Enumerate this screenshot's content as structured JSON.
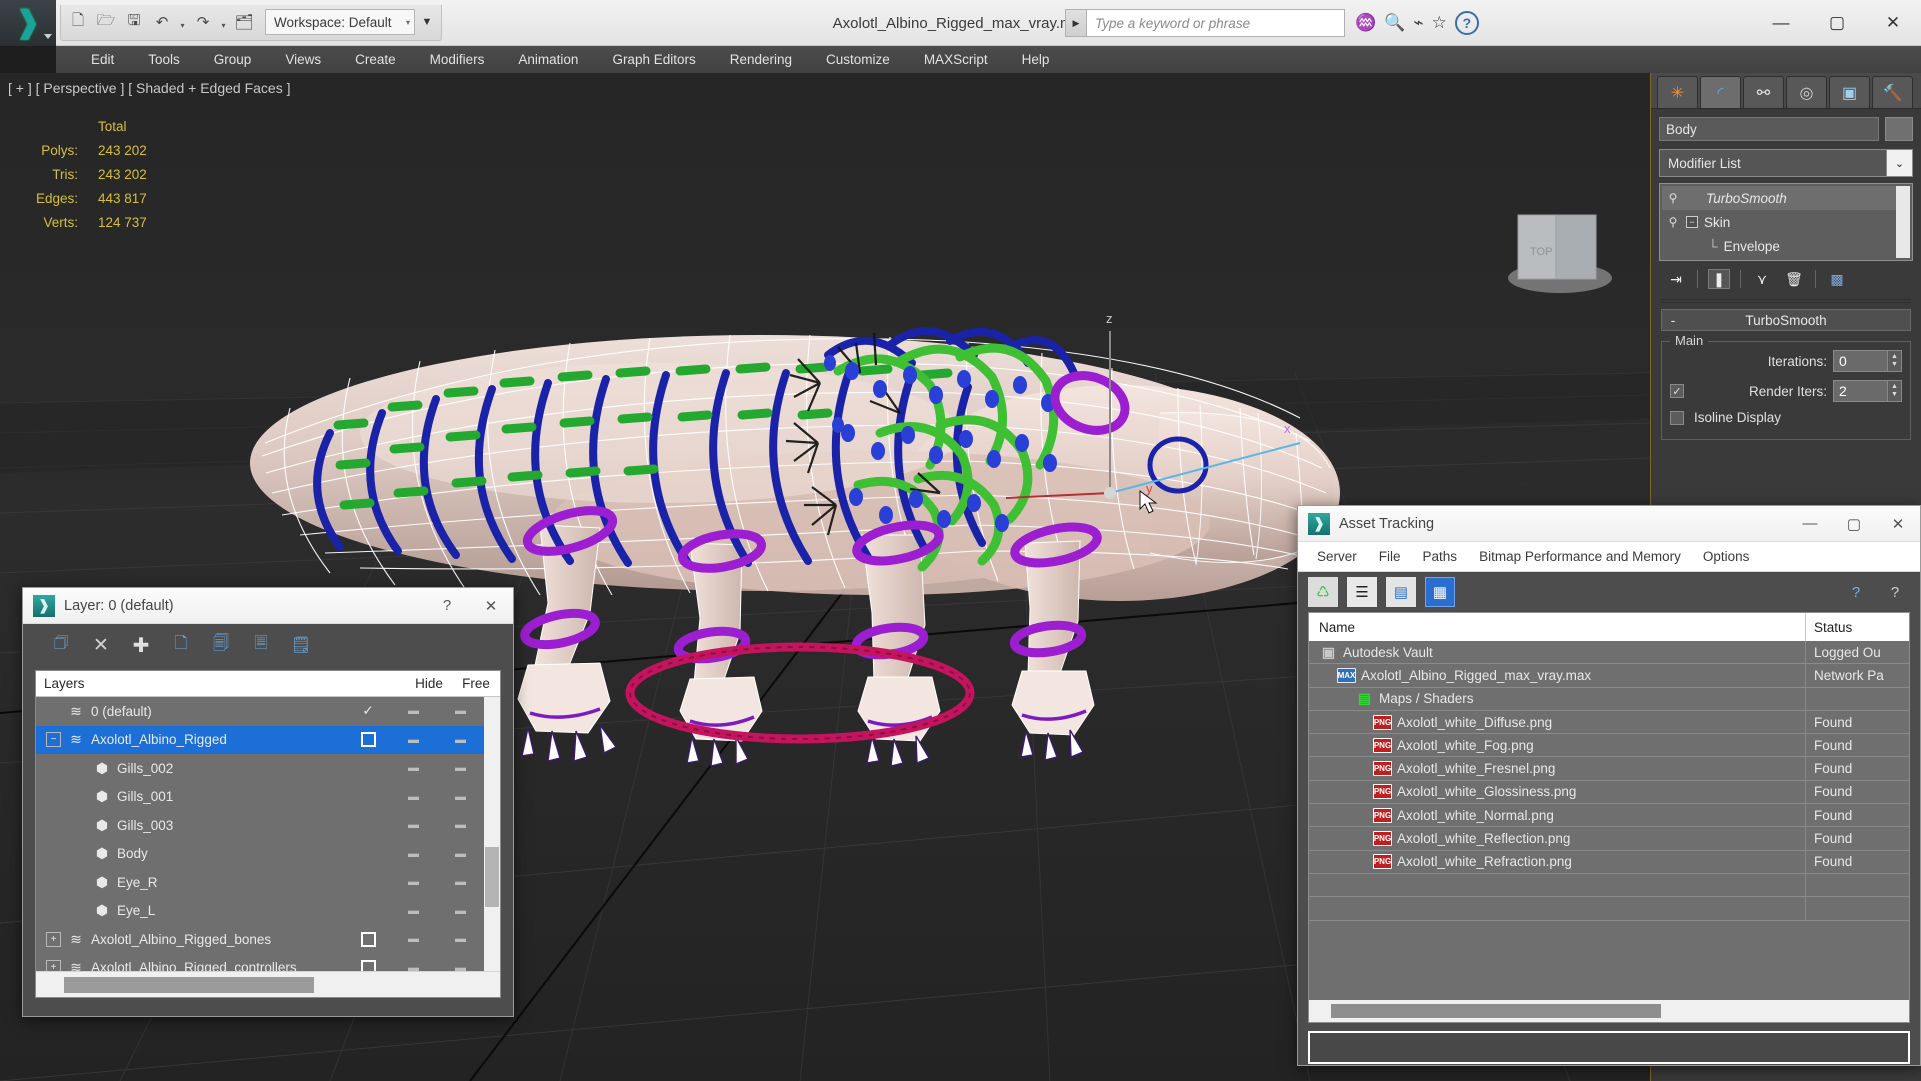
{
  "titlebar": {
    "app_logo": "3dsmax-logo-icon",
    "quick_access": [
      {
        "name": "new-scene-button",
        "glyph": "🗋"
      },
      {
        "name": "open-file-button",
        "glyph": "🗁"
      },
      {
        "name": "save-file-button",
        "glyph": "🖫"
      },
      {
        "name": "undo-button",
        "glyph": "↶"
      },
      {
        "name": "redo-button",
        "glyph": "↷"
      },
      {
        "name": "project-folder-button",
        "glyph": "🗂"
      }
    ],
    "workspace_label": "Workspace: Default",
    "document_title": "Axolotl_Albino_Rigged_max_vray.max",
    "search_placeholder": "Type a keyword or phrase",
    "search_icons": [
      "binoculars-icon",
      "key-icon",
      "satellite-dish-icon",
      "star-icon",
      "help-icon"
    ],
    "window_controls": [
      "minimize-button",
      "maximize-button",
      "close-button"
    ]
  },
  "menubar": {
    "items": [
      "Edit",
      "Tools",
      "Group",
      "Views",
      "Create",
      "Modifiers",
      "Animation",
      "Graph Editors",
      "Rendering",
      "Customize",
      "MAXScript",
      "Help"
    ]
  },
  "viewport": {
    "label": "[ + ] [ Perspective ] [ Shaded + Edged Faces ]",
    "stats_header": "Total",
    "stats": [
      {
        "label": "Polys:",
        "value": "243 202"
      },
      {
        "label": "Tris:",
        "value": "243 202"
      },
      {
        "label": "Edges:",
        "value": "443 817"
      },
      {
        "label": "Verts:",
        "value": "124 737"
      }
    ],
    "axis_labels": {
      "z": "z",
      "x": "x",
      "y": "y"
    },
    "rig_colors": {
      "spine_controllers": "#1a23a8",
      "bone_highlights": "#25a830",
      "limb_controllers": "#9b1fd0",
      "root_controller": "#c4145e",
      "gill_points": "#2a3fd6",
      "mesh_wire": "#ffffff"
    }
  },
  "command_panel": {
    "tabs": [
      {
        "name": "create-tab",
        "glyph": "✳",
        "active": false
      },
      {
        "name": "modify-tab",
        "glyph": "⌒",
        "active": true
      },
      {
        "name": "hierarchy-tab",
        "glyph": "⚯",
        "active": false
      },
      {
        "name": "motion-tab",
        "glyph": "◎",
        "active": false
      },
      {
        "name": "display-tab",
        "glyph": "▣",
        "active": false
      },
      {
        "name": "utilities-tab",
        "glyph": "🔨",
        "active": false
      }
    ],
    "object_name": "Body",
    "modifier_list_label": "Modifier List",
    "modifier_stack": [
      {
        "name": "TurboSmooth",
        "selected": true,
        "italic": true,
        "expandable": false,
        "indent": 0
      },
      {
        "name": "Skin",
        "selected": false,
        "italic": false,
        "expandable": true,
        "indent": 0
      },
      {
        "name": "Envelope",
        "selected": false,
        "italic": false,
        "expandable": false,
        "indent": 1
      }
    ],
    "stack_tool_icons": [
      "pin-stack-icon",
      "show-end-result-icon",
      "make-unique-icon",
      "remove-modifier-icon",
      "configure-modifier-sets-icon"
    ],
    "rollout": {
      "title": "TurboSmooth",
      "collapse_glyph": "-",
      "group_label": "Main",
      "params": [
        {
          "label": "Iterations:",
          "value": "0",
          "checkbox": null
        },
        {
          "label": "Render Iters:",
          "value": "2",
          "checkbox": true
        },
        {
          "label": "Isoline Display",
          "value": null,
          "checkbox": false
        }
      ]
    }
  },
  "layer_dialog": {
    "title": "Layer: 0 (default)",
    "help_glyph": "?",
    "close_glyph": "✕",
    "toolbar": [
      {
        "name": "create-new-layer-icon",
        "glyph": "🗇"
      },
      {
        "name": "delete-layer-icon",
        "glyph": "✕"
      },
      {
        "name": "add-layer-icon",
        "glyph": "✚"
      },
      {
        "name": "select-objects-in-layer-icon",
        "glyph": "🗋"
      },
      {
        "name": "add-selection-to-layer-icon",
        "glyph": "🗐"
      },
      {
        "name": "set-current-layer-icon",
        "glyph": "🗏"
      },
      {
        "name": "layer-properties-icon",
        "glyph": "🗒"
      }
    ],
    "columns": [
      "Layers",
      "",
      "Hide",
      "Free"
    ],
    "rows": [
      {
        "name": "0 (default)",
        "icon": "layer-icon",
        "indent": 0,
        "expandable": false,
        "selected": false,
        "current": true,
        "checkbox": false
      },
      {
        "name": "Axolotl_Albino_Rigged",
        "icon": "layer-icon",
        "indent": 0,
        "expandable": true,
        "expand_glyph": "−",
        "selected": true,
        "current": false,
        "checkbox": true
      },
      {
        "name": "Gills_002",
        "icon": "object-icon",
        "indent": 1,
        "expandable": false,
        "selected": false,
        "current": false,
        "checkbox": false
      },
      {
        "name": "Gills_001",
        "icon": "object-icon",
        "indent": 1,
        "expandable": false,
        "selected": false,
        "current": false,
        "checkbox": false
      },
      {
        "name": "Gills_003",
        "icon": "object-icon",
        "indent": 1,
        "expandable": false,
        "selected": false,
        "current": false,
        "checkbox": false
      },
      {
        "name": "Body",
        "icon": "object-icon",
        "indent": 1,
        "expandable": false,
        "selected": false,
        "current": false,
        "checkbox": false
      },
      {
        "name": "Eye_R",
        "icon": "object-icon",
        "indent": 1,
        "expandable": false,
        "selected": false,
        "current": false,
        "checkbox": false
      },
      {
        "name": "Eye_L",
        "icon": "object-icon",
        "indent": 1,
        "expandable": false,
        "selected": false,
        "current": false,
        "checkbox": false
      },
      {
        "name": "Axolotl_Albino_Rigged_bones",
        "icon": "layer-icon",
        "indent": 0,
        "expandable": true,
        "expand_glyph": "+",
        "selected": false,
        "current": false,
        "checkbox": true
      },
      {
        "name": "Axolotl_Albino_Rigged_controllers",
        "icon": "layer-icon",
        "indent": 0,
        "expandable": true,
        "expand_glyph": "+",
        "selected": false,
        "current": false,
        "checkbox": true
      }
    ]
  },
  "asset_dialog": {
    "title": "Asset Tracking",
    "window_controls": [
      "minimize-button",
      "maximize-button",
      "close-button"
    ],
    "menu": [
      "Server",
      "File",
      "Paths",
      "Bitmap Performance and Memory",
      "Options"
    ],
    "toolbar": [
      {
        "name": "refresh-icon",
        "glyph": "♺",
        "active": false
      },
      {
        "name": "list-view-icon",
        "glyph": "☰",
        "active": false
      },
      {
        "name": "detail-view-icon",
        "glyph": "▤",
        "active": false
      },
      {
        "name": "grid-view-icon",
        "glyph": "▦",
        "active": true
      }
    ],
    "toolbar_right": [
      {
        "name": "web-help-icon",
        "glyph": "?"
      },
      {
        "name": "help-icon",
        "glyph": "?"
      }
    ],
    "columns": [
      "Name",
      "Status"
    ],
    "rows": [
      {
        "name": "Autodesk Vault",
        "status": "Logged Ou",
        "indent": 0,
        "icon": "vault",
        "icon_text": "▣"
      },
      {
        "name": "Axolotl_Albino_Rigged_max_vray.max",
        "status": "Network Pa",
        "indent": 1,
        "icon": "max",
        "icon_text": "MAX"
      },
      {
        "name": "Maps / Shaders",
        "status": "",
        "indent": 2,
        "icon": "maps",
        "icon_text": "▤"
      },
      {
        "name": "Axolotl_white_Diffuse.png",
        "status": "Found",
        "indent": 3,
        "icon": "png",
        "icon_text": "PNG"
      },
      {
        "name": "Axolotl_white_Fog.png",
        "status": "Found",
        "indent": 3,
        "icon": "png",
        "icon_text": "PNG"
      },
      {
        "name": "Axolotl_white_Fresnel.png",
        "status": "Found",
        "indent": 3,
        "icon": "png",
        "icon_text": "PNG"
      },
      {
        "name": "Axolotl_white_Glossiness.png",
        "status": "Found",
        "indent": 3,
        "icon": "png",
        "icon_text": "PNG"
      },
      {
        "name": "Axolotl_white_Normal.png",
        "status": "Found",
        "indent": 3,
        "icon": "png",
        "icon_text": "PNG"
      },
      {
        "name": "Axolotl_white_Reflection.png",
        "status": "Found",
        "indent": 3,
        "icon": "png",
        "icon_text": "PNG"
      },
      {
        "name": "Axolotl_white_Refraction.png",
        "status": "Found",
        "indent": 3,
        "icon": "png",
        "icon_text": "PNG"
      },
      {
        "name": "",
        "status": "",
        "indent": 0,
        "icon": "none",
        "icon_text": ""
      },
      {
        "name": "",
        "status": "",
        "indent": 0,
        "icon": "none",
        "icon_text": ""
      }
    ]
  }
}
